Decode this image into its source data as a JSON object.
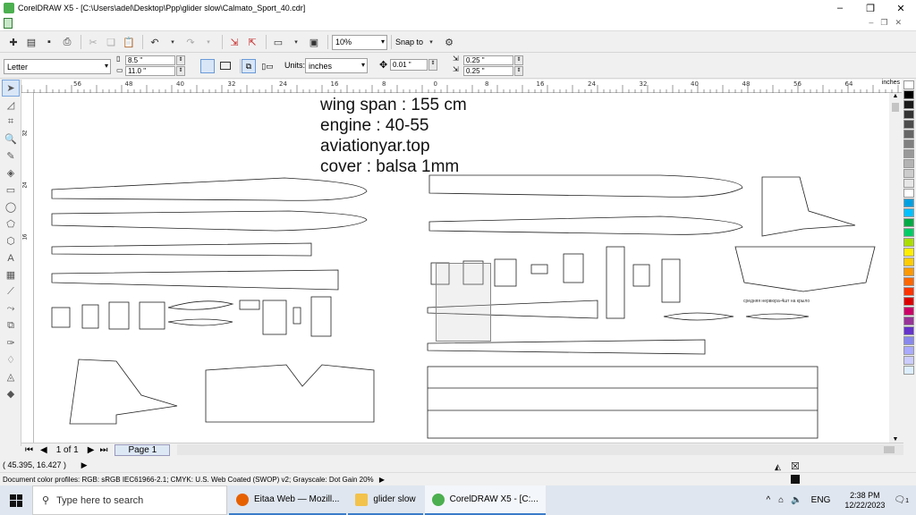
{
  "window": {
    "title": "CorelDRAW X5 - [C:\\Users\\adel\\Desktop\\Ppp\\glider slow\\Calmato_Sport_40.cdr]",
    "controls": [
      "–",
      "❐",
      "✕"
    ]
  },
  "toolbar1": {
    "zoom": "10%",
    "snap_to": "Snap to"
  },
  "toolbar2": {
    "paper": "Letter",
    "width": "8.5 \"",
    "height": "11.0 \"",
    "units_label": "Units:",
    "units": "inches",
    "nudge": "0.01 \"",
    "dup_x": "0.25 \"",
    "dup_y": "0.25 \""
  },
  "ruler": {
    "unit": "inches",
    "top_ticks": [
      "56",
      "48",
      "40",
      "32",
      "24",
      "16",
      "8",
      "0",
      "8",
      "16",
      "24",
      "32",
      "40",
      "48",
      "56",
      "64"
    ],
    "left_ticks": [
      "32",
      "24",
      "16"
    ]
  },
  "canvas": {
    "notes": [
      "wing span : 155 cm",
      "engine : 40-55",
      "aviationyar.top",
      "cover : balsa 1mm"
    ],
    "small_label": "средняя нервюра-4шт на крыло"
  },
  "pages": {
    "counter": "1 of 1",
    "tab": "Page 1"
  },
  "status": {
    "cursor_pos": "( 45.395, 16.427 )",
    "color_profiles": "Document color profiles: RGB: sRGB IEC61966-2.1; CMYK: U.S. Web Coated (SWOP) v2; Grayscale: Dot Gain 20%"
  },
  "taskbar": {
    "search_placeholder": "Type here to search",
    "apps": [
      {
        "label": "Eitaa Web — Mozill...",
        "color": "#e66000"
      },
      {
        "label": "glider slow",
        "color": "#f2c24b"
      },
      {
        "label": "CorelDRAW X5 - [C:...",
        "color": "#4caf50"
      }
    ],
    "lang": "ENG",
    "time": "2:38 PM",
    "date": "12/22/2023",
    "notif_count": "1"
  },
  "palette": [
    "#ffffff",
    "#000000",
    "#1a1a1a",
    "#333333",
    "#4d4d4d",
    "#666666",
    "#808080",
    "#999999",
    "#b3b3b3",
    "#cccccc",
    "#e6e6e6",
    "#ffffff",
    "#00a0e0",
    "#00c0ff",
    "#00aa44",
    "#00cc66",
    "#aadd00",
    "#ffee00",
    "#ffcc00",
    "#ff9900",
    "#ff6600",
    "#ff3300",
    "#dd0000",
    "#cc0066",
    "#993399",
    "#6633cc",
    "#8888ee",
    "#aaaaff",
    "#ccccff",
    "#ddeeff"
  ]
}
